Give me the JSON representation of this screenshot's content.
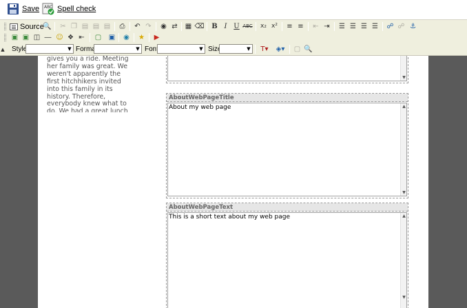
{
  "topbar": {
    "save_label": "Save",
    "spell_label": "Spell check"
  },
  "toolbar": {
    "source_label": "Source",
    "style_label": "Style",
    "format_label": "Format",
    "font_label": "Font",
    "size_label": "Size",
    "style_value": "",
    "format_value": "",
    "font_value": "",
    "size_value": ""
  },
  "page": {
    "story_text": "gives you a ride. Meeting her family was great. We weren't apparently the first hitchhikers invited into this family in its history. Therefore, everybody knew what to do. We had a great lunch and only because our busy schedule we had to refused to spend a night there",
    "regions": [
      {
        "title": "",
        "content": ""
      },
      {
        "title": "AboutWebPageTitle",
        "content": "About my web page"
      },
      {
        "title": "AboutWebPageText",
        "content": "This is a short text about my web page"
      }
    ]
  },
  "colors": {
    "toolbar_bg": "#efefde",
    "margin_dark": "#5a5a5a",
    "region_title_bg": "#e6e6e6"
  }
}
